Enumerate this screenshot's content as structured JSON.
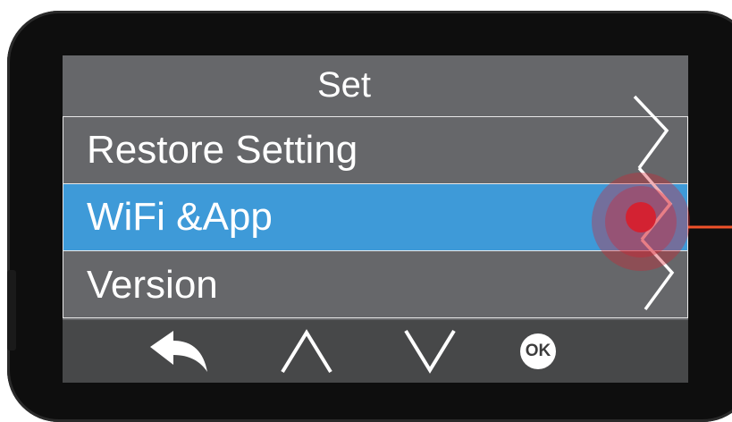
{
  "screen": {
    "title": "Set",
    "menu_items": [
      {
        "label": "Restore Setting",
        "selected": false
      },
      {
        "label": "WiFi &App",
        "selected": true
      },
      {
        "label": "Version",
        "selected": false
      }
    ]
  },
  "bottom_bar": {
    "buttons": [
      {
        "name": "back",
        "icon": "back-arrow-icon"
      },
      {
        "name": "up",
        "icon": "chevron-up-icon"
      },
      {
        "name": "down",
        "icon": "chevron-down-icon"
      },
      {
        "name": "ok",
        "icon": "ok-icon",
        "label": "OK"
      }
    ]
  },
  "colors": {
    "screen_background": "#66676a",
    "selected_row": "#3e9ad8",
    "bottom_bar": "#474849",
    "touch_indicator": "#d6202e",
    "pointer_line": "#f0522a"
  }
}
